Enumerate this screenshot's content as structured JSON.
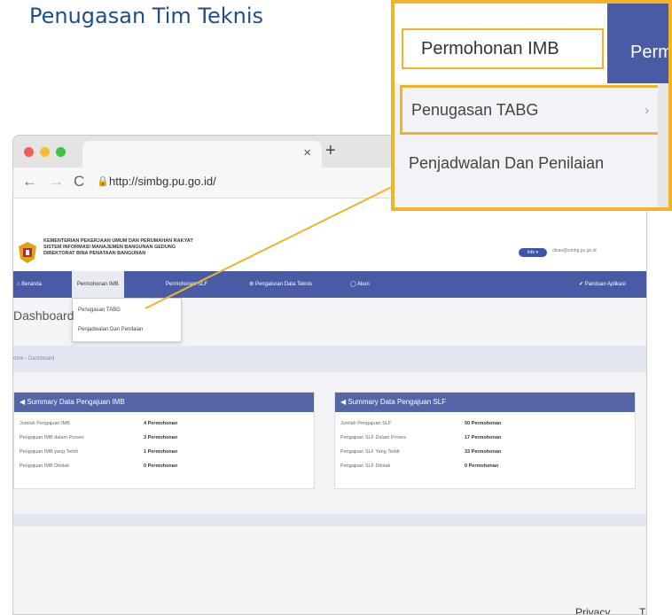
{
  "page_title": "Penugasan Tim Teknis",
  "browser": {
    "url": "http://simbg.pu.go.id/",
    "tab_close": "×",
    "new_tab": "+"
  },
  "site": {
    "ministry_line1": "KEMENTERIAN PEKERJAAN UMUM DAN PERUMAHAN RAKYAT",
    "ministry_line2": "SISTEM INFORMASI MANAJEMEN BANGUNAN GEDUNG",
    "ministry_line3": "DIREKTORAT BINA PENATAAN BANGUNAN",
    "user_badge": "Info ▾",
    "user_email": "dinas@simbg.pu.go.id",
    "nav": {
      "beranda": "⌂ Beranda",
      "permohonan_imb": "Permohonan IMB",
      "permohonan_slf": "Permohonan SLF",
      "pengaturan": "⚙ Pengaturan Data Teknis",
      "akun": "◯ Akun",
      "panduan": "✔ Panduan Aplikasi"
    },
    "dropdown": {
      "item1": "Penugasan TABG",
      "item2": "Penjadwalan Dan Penilaian"
    },
    "dashboard_title": "Dashboard",
    "breadcrumb": "ome › Dashboard",
    "card_imb": {
      "title": "◀ Summary Data Pengajuan IMB",
      "rows": [
        {
          "label": "Jumlah Pengajuan IMB",
          "value": "4 Permohonan"
        },
        {
          "label": "Pengajuan IMB dalam Proses",
          "value": "3 Permohonan"
        },
        {
          "label": "Pengajuan IMB yang Terbit",
          "value": "1 Permohonan"
        },
        {
          "label": "Pengajuan IMB Ditolak",
          "value": "0 Permohonan"
        }
      ]
    },
    "card_slf": {
      "title": "◀ Summary Data Pengajuan SLF",
      "rows": [
        {
          "label": "Jumlah Pengajuan SLF",
          "value": "50 Permohonan"
        },
        {
          "label": "Pengajuan SLF Dalam Proses",
          "value": "17 Permohonan"
        },
        {
          "label": "Pengajuan SLF Yang Terbit",
          "value": "33 Permohonan"
        },
        {
          "label": "Pengajuan SLF Ditolak",
          "value": "0 Permohonan"
        }
      ]
    },
    "footer_privacy": "Privacy",
    "footer_more": "T"
  },
  "zoom": {
    "menu_button": "Permohonan IMB",
    "next_menu": "Perm",
    "item1": "Penugasan TABG",
    "item2": "Penjadwalan Dan Penilaian"
  },
  "colors": {
    "accent": "#f0b429",
    "navbar": "#4a5ba6",
    "title": "#1f4f8b"
  }
}
